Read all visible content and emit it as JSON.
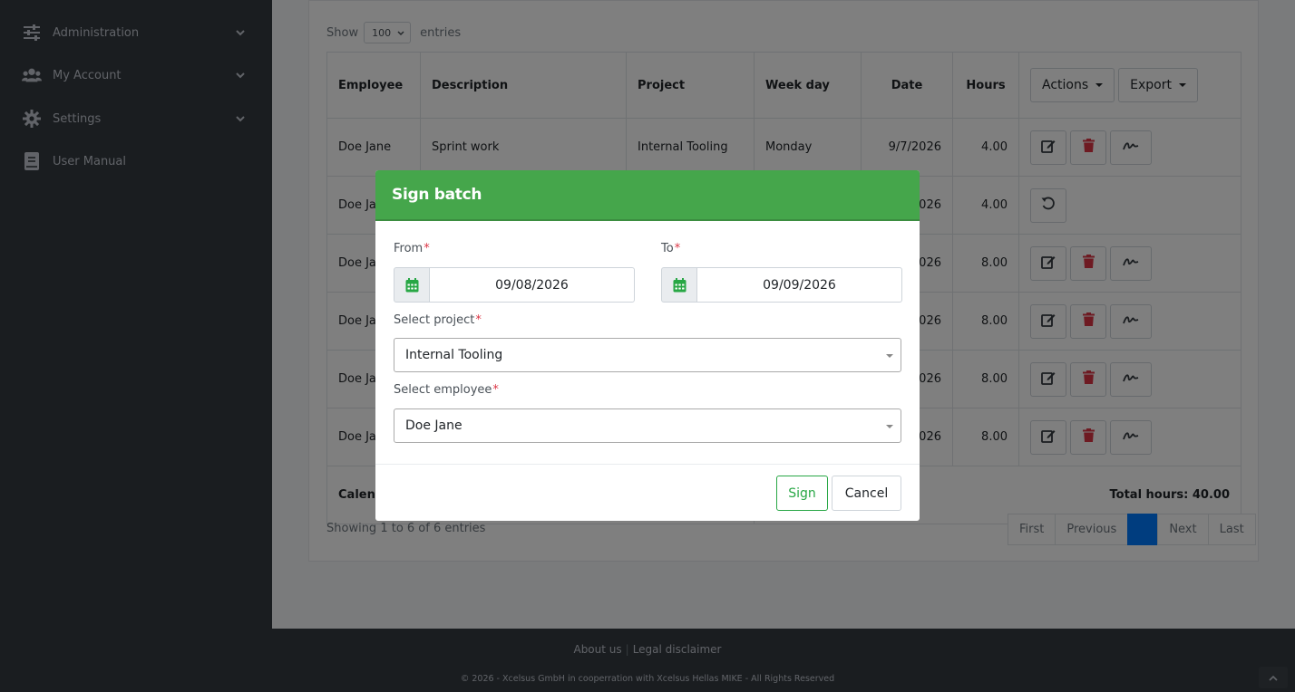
{
  "sidebar": {
    "items": [
      {
        "label": "Administration",
        "icon": "sliders-icon",
        "has_chevron": true
      },
      {
        "label": "My Account",
        "icon": "users-icon",
        "has_chevron": true
      },
      {
        "label": "Settings",
        "icon": "gear-icon",
        "has_chevron": true
      },
      {
        "label": "User Manual",
        "icon": "book-icon",
        "has_chevron": false
      }
    ]
  },
  "table": {
    "show_label": "Show",
    "entries_value": "100",
    "entries_label": "entries",
    "columns": [
      "Employee",
      "Description",
      "Project",
      "Week day",
      "Date",
      "Hours"
    ],
    "actions_label": "Actions",
    "export_label": "Export",
    "rows": [
      {
        "employee": "Doe Jane",
        "description": "Sprint work",
        "project": "Internal Tooling",
        "weekday": "Monday",
        "date": "9/7/2026",
        "hours": "4.00",
        "state": "editable"
      },
      {
        "employee": "Doe Ja",
        "description": "",
        "project": "",
        "weekday": "",
        "date": "026",
        "hours": "4.00",
        "state": "signed"
      },
      {
        "employee": "Doe Ja",
        "description": "",
        "project": "",
        "weekday": "",
        "date": "026",
        "hours": "8.00",
        "state": "editable"
      },
      {
        "employee": "Doe Ja",
        "description": "",
        "project": "",
        "weekday": "",
        "date": "026",
        "hours": "8.00",
        "state": "editable"
      },
      {
        "employee": "Doe Ja",
        "description": "",
        "project": "",
        "weekday": "",
        "date": "026",
        "hours": "8.00",
        "state": "editable"
      },
      {
        "employee": "Doe Ja",
        "description": "",
        "project": "",
        "weekday": "",
        "date": "026",
        "hours": "8.00",
        "state": "editable"
      }
    ],
    "footer_left": "Calen",
    "total_hours": "Total hours: 40.00",
    "showing_text": "Showing 1 to 6 of 6 entries",
    "pagination": {
      "first": "First",
      "previous": "Previous",
      "current": "",
      "next": "Next",
      "last": "Last"
    }
  },
  "footer": {
    "about": "About us",
    "separator": "|",
    "disclaimer": "Legal disclaimer",
    "copyright": "© 2026 - Xcelsus GmbH in cooperration with Xcelsus Hellas MIKE - All Rights Reserved"
  },
  "modal": {
    "title": "Sign batch",
    "from_label": "From",
    "from_value": "09/08/2026",
    "to_label": "To",
    "to_value": "09/09/2026",
    "project_label": "Select project",
    "project_value": "Internal Tooling",
    "employee_label": "Select employee",
    "employee_value": "Doe Jane",
    "required_mark": "*",
    "sign_label": "Sign",
    "cancel_label": "Cancel"
  },
  "colors": {
    "modal_header": "#45a64b",
    "sidebar_bg": "#343a40",
    "delete_icon": "#dc3545",
    "sign_button": "#28a745",
    "active_page": "#007bff"
  }
}
